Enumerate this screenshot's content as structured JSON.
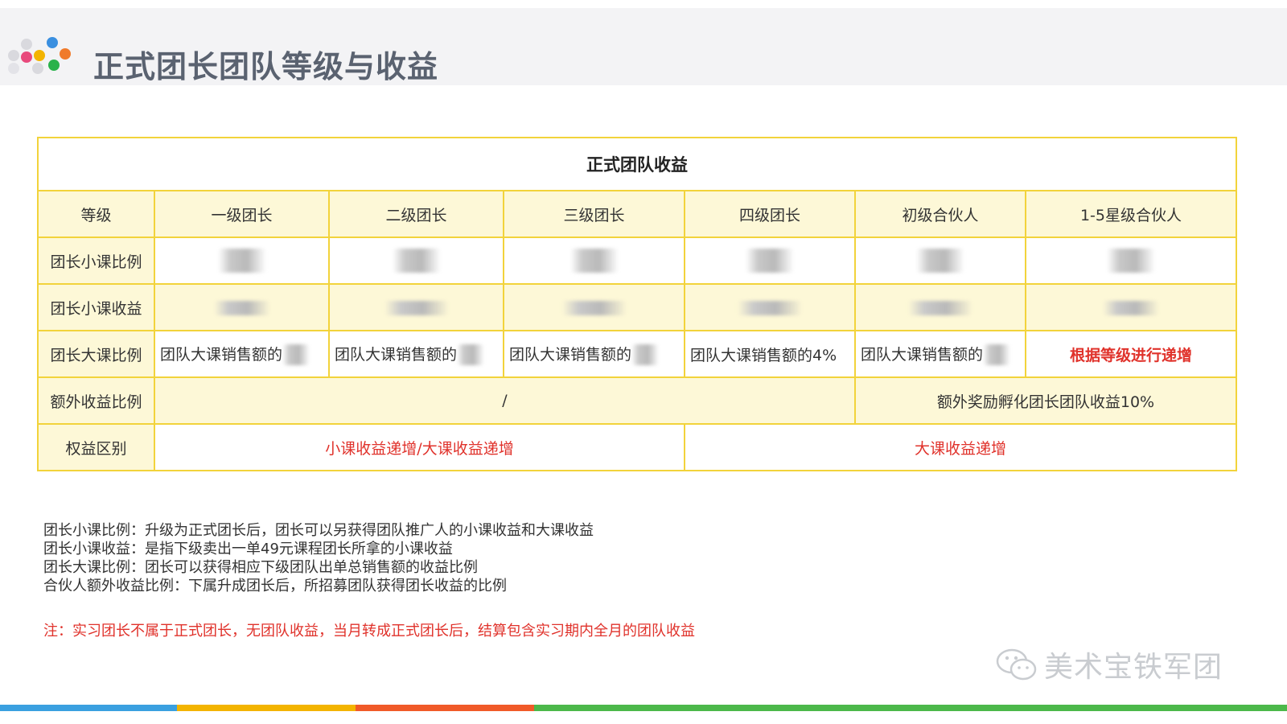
{
  "header": {
    "title": "正式团长团队等级与收益",
    "logo_colors": [
      "#3a8fe0",
      "#e03a5a",
      "#f3b400",
      "#2ab24b",
      "#f07a2a",
      "#cfcfd4"
    ]
  },
  "table": {
    "title": "正式团队收益",
    "columns": [
      "等级",
      "一级团长",
      "二级团长",
      "三级团长",
      "四级团长",
      "初级合伙人",
      "1-5星级合伙人"
    ],
    "rows": {
      "small_ratio": {
        "label": "团长小课比例"
      },
      "small_income": {
        "label": "团长小课收益"
      },
      "big_ratio": {
        "label": "团长大课比例",
        "cells": [
          "团队大课销售额的",
          "团队大课销售额的",
          "团队大课销售额的",
          "团队大课销售额的4%",
          "团队大课销售额的",
          "根据等级进行递增"
        ]
      },
      "extra_ratio": {
        "label": "额外收益比例",
        "left": "/",
        "right": "额外奖励孵化团长团队收益10%"
      },
      "rights": {
        "label": "权益区别",
        "left": "小课收益递增/大课收益递增",
        "right": "大课收益递增"
      }
    }
  },
  "notes": [
    "团长小课比例：升级为正式团长后，团长可以另获得团队推广人的小课收益和大课收益",
    "团长小课收益：是指下级卖出一单49元课程团长所拿的小课收益",
    "团长大课比例：团长可以获得相应下级团队出单总销售额的收益比例",
    "合伙人额外收益比例：下属升成团长后，所招募团队获得团长收益的比例"
  ],
  "warning": "注：实习团长不属于正式团长，无团队收益，当月转成正式团长后，结算包含实习期内全月的团队收益",
  "watermark": {
    "text": "美术宝铁军团",
    "icon": "wechat-icon"
  },
  "bottom_bar_colors": [
    "#3aa0e0",
    "#f3b400",
    "#f05a28",
    "#4cb84a"
  ]
}
